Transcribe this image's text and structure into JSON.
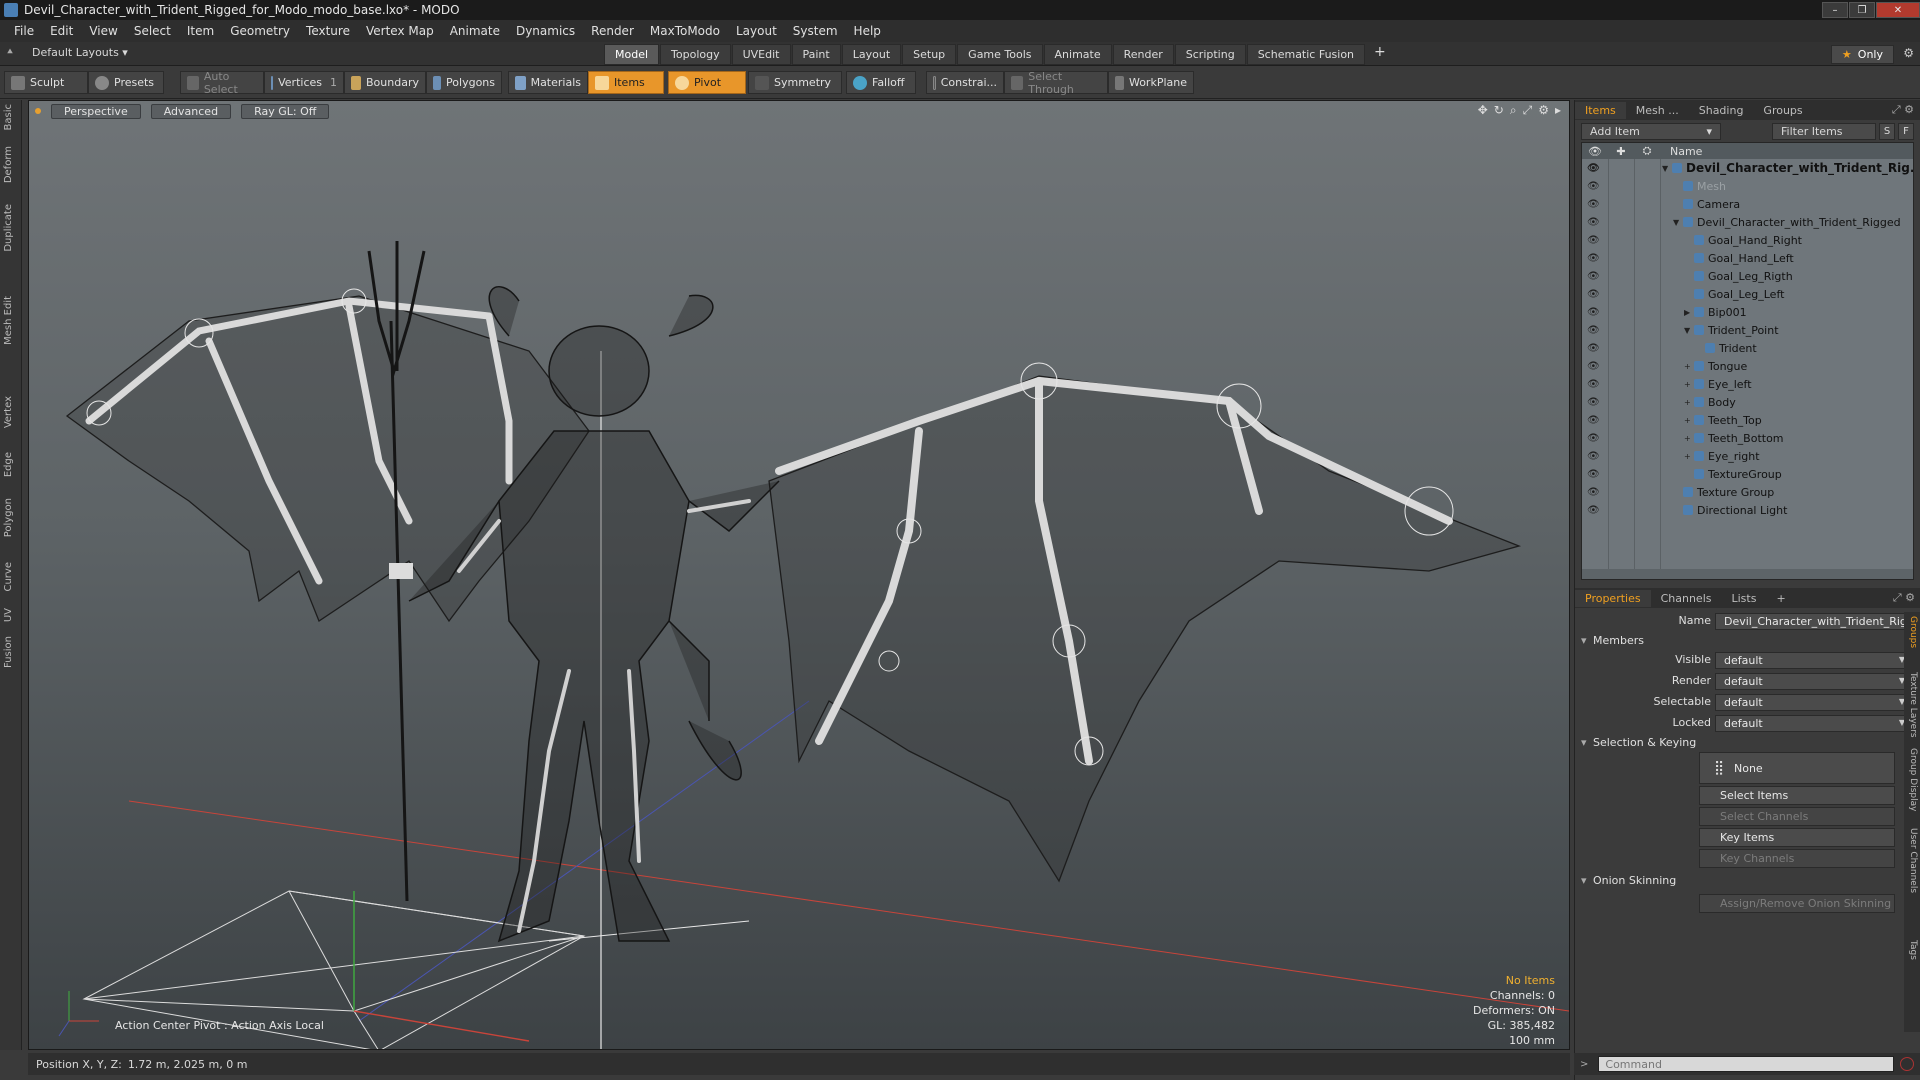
{
  "window": {
    "title": "Devil_Character_with_Trident_Rigged_for_Modo_modo_base.lxo* - MODO",
    "controls": [
      "–",
      "❐",
      "✕"
    ]
  },
  "menubar": [
    "File",
    "Edit",
    "View",
    "Select",
    "Item",
    "Geometry",
    "Texture",
    "Vertex Map",
    "Animate",
    "Dynamics",
    "Render",
    "MaxToModo",
    "Layout",
    "System",
    "Help"
  ],
  "layout_selector": "Default Layouts ▾",
  "layout_tabs": [
    "Model",
    "Topology",
    "UVEdit",
    "Paint",
    "Layout",
    "Setup",
    "Game Tools",
    "Animate",
    "Render",
    "Scripting",
    "Schematic Fusion"
  ],
  "active_layout_tab": "Model",
  "only_label": "Only",
  "toolbar": {
    "sculpt": "Sculpt",
    "presets": "Presets",
    "auto_select": "Auto Select",
    "vertices": "Vertices",
    "vertices_count": "1",
    "boundary": "Boundary",
    "polygons": "Polygons",
    "materials": "Materials",
    "items": "Items",
    "pivot": "Pivot",
    "symmetry": "Symmetry",
    "falloff": "Falloff",
    "constrain": "Constrai...",
    "select_through": "Select Through",
    "workplane": "WorkPlane"
  },
  "left_tabs": [
    "Basic",
    "Deform",
    "Duplicate",
    "Mesh Edit",
    "Vertex",
    "Edge",
    "Polygon",
    "Curve",
    "UV",
    "Fusion"
  ],
  "viewport": {
    "buttons": [
      "Perspective",
      "Advanced",
      "Ray GL: Off"
    ],
    "action_center": "Action Center Pivot : Action Axis Local",
    "info": {
      "no_items": "No Items",
      "channels": "Channels: 0",
      "deformers": "Deformers: ON",
      "gl": "GL: 385,482",
      "scale": "100 mm"
    }
  },
  "statusbar": {
    "position_label": "Position X, Y, Z:",
    "position_value": "1.72 m, 2.025 m, 0 m"
  },
  "items_panel": {
    "tabs": [
      "Items",
      "Mesh ...",
      "Shading",
      "Groups"
    ],
    "add_item": "Add Item",
    "filter_placeholder": "Filter Items",
    "s_btn": "S",
    "f_btn": "F",
    "name_header": "Name",
    "tree": [
      {
        "label": "Devil_Character_with_Trident_Rig...",
        "indent": 0,
        "expander": "▼",
        "bold": true
      },
      {
        "label": "Mesh",
        "indent": 1,
        "expander": "",
        "dim": true
      },
      {
        "label": "Camera",
        "indent": 1,
        "expander": ""
      },
      {
        "label": "Devil_Character_with_Trident_Rigged",
        "indent": 1,
        "expander": "▼"
      },
      {
        "label": "Goal_Hand_Right",
        "indent": 2,
        "expander": ""
      },
      {
        "label": "Goal_Hand_Left",
        "indent": 2,
        "expander": ""
      },
      {
        "label": "Goal_Leg_Rigth",
        "indent": 2,
        "expander": ""
      },
      {
        "label": "Goal_Leg_Left",
        "indent": 2,
        "expander": ""
      },
      {
        "label": "Bip001",
        "indent": 2,
        "expander": "▶"
      },
      {
        "label": "Trident_Point",
        "indent": 2,
        "expander": "▼"
      },
      {
        "label": "Trident",
        "indent": 3,
        "expander": ""
      },
      {
        "label": "Tongue",
        "indent": 2,
        "expander": "+"
      },
      {
        "label": "Eye_left",
        "indent": 2,
        "expander": "+"
      },
      {
        "label": "Body",
        "indent": 2,
        "expander": "+"
      },
      {
        "label": "Teeth_Top",
        "indent": 2,
        "expander": "+"
      },
      {
        "label": "Teeth_Bottom",
        "indent": 2,
        "expander": "+"
      },
      {
        "label": "Eye_right",
        "indent": 2,
        "expander": "+"
      },
      {
        "label": "TextureGroup",
        "indent": 2,
        "expander": ""
      },
      {
        "label": "Texture Group",
        "indent": 1,
        "expander": ""
      },
      {
        "label": "Directional Light",
        "indent": 1,
        "expander": ""
      }
    ]
  },
  "properties_panel": {
    "tabs": [
      "Properties",
      "Channels",
      "Lists",
      "+"
    ],
    "name_label": "Name",
    "name_value": "Devil_Character_with_Trident_Rigged",
    "members_section": "Members",
    "fields": [
      {
        "label": "Visible",
        "value": "default"
      },
      {
        "label": "Render",
        "value": "default"
      },
      {
        "label": "Selectable",
        "value": "default"
      },
      {
        "label": "Locked",
        "value": "default"
      }
    ],
    "selection_section": "Selection & Keying",
    "none_label": "None",
    "buttons": [
      {
        "label": "Select Items",
        "enabled": true
      },
      {
        "label": "Select Channels",
        "enabled": false
      },
      {
        "label": "Key Items",
        "enabled": true
      },
      {
        "label": "Key Channels",
        "enabled": false
      }
    ],
    "onion_section": "Onion Skinning",
    "onion_button": "Assign/Remove Onion Skinning",
    "side_tabs": [
      "Groups",
      "Texture Layers",
      "Group Display",
      "User Channels",
      "Tags"
    ]
  },
  "command": {
    "placeholder": "Command"
  }
}
